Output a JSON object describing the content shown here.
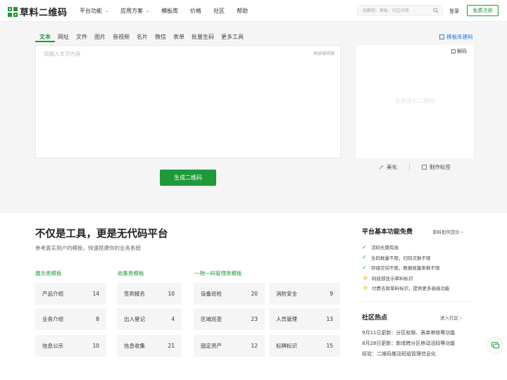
{
  "header": {
    "logo_text": "草料二维码",
    "nav": [
      "平台功能",
      "应用方案",
      "模板库",
      "价格",
      "社区",
      "帮助"
    ],
    "search_placeholder": "找教程、模板、社区问答",
    "login": "登录",
    "register": "免费注册"
  },
  "generator": {
    "tabs": [
      "文本",
      "网址",
      "文件",
      "图片",
      "音视频",
      "名片",
      "微信",
      "表单",
      "批量生码",
      "更多工具"
    ],
    "active_tab": "文本",
    "template_link": "模板库建码",
    "input_placeholder": "请输入文字内容",
    "advanced_editor": "高级编辑器",
    "generate_button": "生成二维码",
    "decode": "解码",
    "preview_placeholder": "此处显示二维码",
    "beautify": "美化",
    "make_label": "制作标签"
  },
  "hero": {
    "title": "不仅是工具，更是无代码平台",
    "subtitle": "参考真实用户的模板，快速搭建你的业务系统"
  },
  "categories": [
    {
      "title": "展示类模板",
      "items": [
        {
          "label": "产品介绍",
          "count": "14"
        },
        {
          "label": "业务介绍",
          "count": "8"
        },
        {
          "label": "信息公示",
          "count": "10"
        }
      ]
    },
    {
      "title": "收集类模板",
      "items": [
        {
          "label": "签到报名",
          "count": "10"
        },
        {
          "label": "出入登记",
          "count": "4"
        },
        {
          "label": "信息收集",
          "count": "21"
        }
      ]
    },
    {
      "title": "一物一码管理类模板",
      "items": [
        {
          "label": "设备巡检",
          "count": "20"
        },
        {
          "label": "区域巡查",
          "count": "23"
        },
        {
          "label": "固定资产",
          "count": "12"
        }
      ]
    },
    {
      "title": "",
      "items": [
        {
          "label": "消防安全",
          "count": "9"
        },
        {
          "label": "人员管理",
          "count": "13"
        },
        {
          "label": "标牌标识",
          "count": "15"
        }
      ]
    }
  ],
  "sidebar": {
    "features_title": "平台基本功能免费",
    "features_more": "草料如何定价",
    "features": [
      {
        "text": "活码长期有效",
        "free": true
      },
      {
        "text": "生码数量不限，扫码次数不限",
        "free": true
      },
      {
        "text": "存储空间不限，数据收集条数不限",
        "free": true
      },
      {
        "text": "码底部显示草料标识",
        "free": false
      },
      {
        "text": "付费去除草料标识，提供更多高级功能",
        "free": false
      }
    ],
    "community_title": "社区热点",
    "community_more": "进入社区",
    "news": [
      "9月11日更新：分区权限、表单审核等功能",
      "8月28日更新：新增跨分区移动活码等功能",
      "经验：二维码推动班组管理信息化"
    ]
  },
  "colors": {
    "brand_green": "#1f9a3b",
    "link_blue": "#2a7bd6",
    "gray_bg": "#f5f5f5"
  }
}
